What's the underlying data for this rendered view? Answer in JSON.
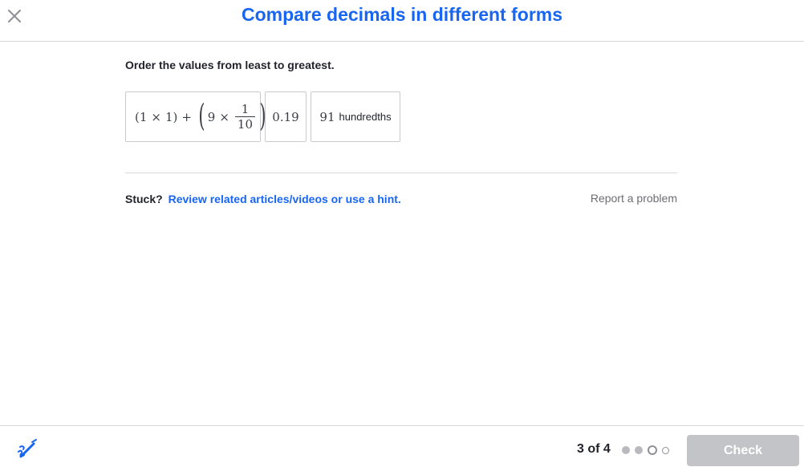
{
  "header": {
    "title": "Compare decimals in different forms",
    "close_icon": "close-icon",
    "title_color": "#1865f2"
  },
  "question": {
    "prompt": "Order the values from least to greatest.",
    "cards": [
      {
        "id": "expanded",
        "parts": {
          "open1": "(",
          "a": "1",
          "times1": "×",
          "b": "1",
          "close1": ")",
          "plus": "+",
          "open2": "(",
          "c": "9",
          "times2": "×",
          "num": "1",
          "den": "10",
          "close2": ")"
        }
      },
      {
        "id": "decimal",
        "value": "0.19"
      },
      {
        "id": "hundredths",
        "number": "91",
        "unit": "hundredths"
      }
    ]
  },
  "help": {
    "stuck_label": "Stuck?",
    "stuck_link": "Review related articles/videos or use a hint.",
    "report": "Report a problem"
  },
  "footer": {
    "scratchpad_icon": "pencil-icon",
    "progress": "3 of 4",
    "current_step": 3,
    "total_steps": 4,
    "check": "Check",
    "check_disabled_color": "#c3c4c7"
  }
}
